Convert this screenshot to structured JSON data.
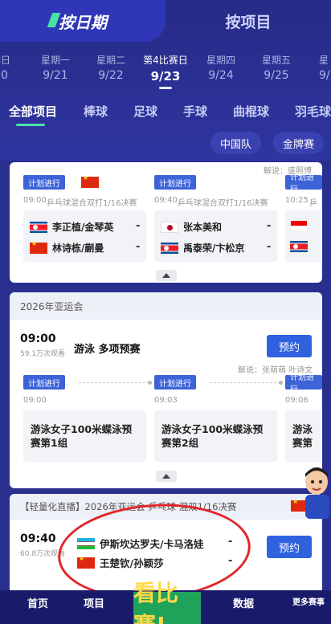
{
  "tabs": {
    "by_date": "按日期",
    "by_event": "按项目"
  },
  "dates": [
    {
      "weekday": "期日",
      "date": "20"
    },
    {
      "weekday": "星期一",
      "date": "9/21"
    },
    {
      "weekday": "星期二",
      "date": "9/22"
    },
    {
      "weekday": "第4比赛日",
      "date": "9/23"
    },
    {
      "weekday": "星期四",
      "date": "9/24"
    },
    {
      "weekday": "星期五",
      "date": "9/25"
    },
    {
      "weekday": "星",
      "date": "9/"
    }
  ],
  "sports": [
    "全部项目",
    "棒球",
    "足球",
    "手球",
    "曲棍球",
    "羽毛球"
  ],
  "filters": {
    "china_team": "中国队",
    "gold_match": "金牌赛"
  },
  "pingpong": {
    "commentary": "解说：盛照博",
    "plan_label": "计划进行",
    "matches": [
      {
        "time": "09:00",
        "event": "乒乓球混合双打1/16决赛",
        "p1": "李正植/金琴英",
        "p2": "林诗栋/蒯曼",
        "s1": "-",
        "s2": "-"
      },
      {
        "time": "09:40",
        "event": "乒乓球混合双打1/16决赛",
        "p1": "张本美和",
        "p2": "禹泰荣/卞松京",
        "s1": "-",
        "s2": "-"
      },
      {
        "time": "10:25",
        "event": "乒",
        "p1": "",
        "p2": "",
        "s1": "-",
        "s2": "-"
      }
    ]
  },
  "swim": {
    "header": "2026年亚运会",
    "time": "09:00",
    "viewers": "59.1万次观看",
    "title": "游泳 多项预赛",
    "reserve": "预约",
    "commentary": "解说：张萌萌 叶诗文",
    "plan_label": "计划进行",
    "events": [
      {
        "time": "09:00",
        "line1": "游泳女子100米蝶泳预",
        "line2": "赛第1组"
      },
      {
        "time": "09:03",
        "line1": "游泳女子100米蝶泳预",
        "line2": "赛第2组"
      },
      {
        "time": "09:06",
        "line1": "游泳",
        "line2": "赛第"
      }
    ]
  },
  "live": {
    "header": "【轻量化直播】2026年亚运会 乒乓球 混双1/16决赛",
    "time": "09:40",
    "viewers": "60.8万次观看",
    "p1": "伊斯坎达罗夫/卡马洛娃",
    "p2": "王楚钦/孙颖莎",
    "s1": "-",
    "s2": "-",
    "reserve": "预约"
  },
  "bottom_nav": [
    "首页",
    "项目",
    "看比赛!",
    "数据",
    "更多赛事"
  ]
}
